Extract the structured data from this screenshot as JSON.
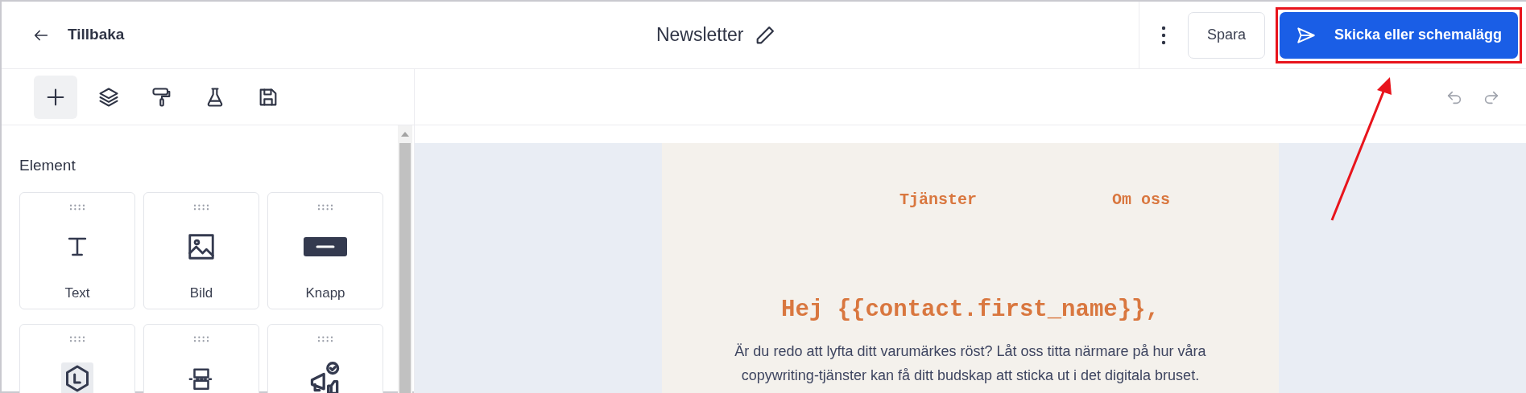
{
  "header": {
    "back": "Tillbaka",
    "title": "Newsletter",
    "save": "Spara",
    "send": "Skicka eller schemalägg"
  },
  "tools": [
    {
      "kind": "add",
      "selected": true
    },
    {
      "kind": "layers",
      "selected": false
    },
    {
      "kind": "style",
      "selected": false
    },
    {
      "kind": "test",
      "selected": false
    },
    {
      "kind": "save",
      "selected": false
    }
  ],
  "panel": {
    "heading": "Element",
    "elements": [
      {
        "kind": "text",
        "label": "Text"
      },
      {
        "kind": "image",
        "label": "Bild"
      },
      {
        "kind": "button",
        "label": "Knapp"
      },
      {
        "kind": "logo"
      },
      {
        "kind": "layout"
      },
      {
        "kind": "social"
      }
    ]
  },
  "email": {
    "nav": [
      "Tjänster",
      "Om oss"
    ],
    "heading": "Hej {{contact.first_name}},",
    "body": "Är du redo att lyfta ditt varumärkes röst? Låt oss titta närmare på hur våra copywriting-tjänster kan få ditt budskap att sticka ut i det digitala bruset."
  }
}
